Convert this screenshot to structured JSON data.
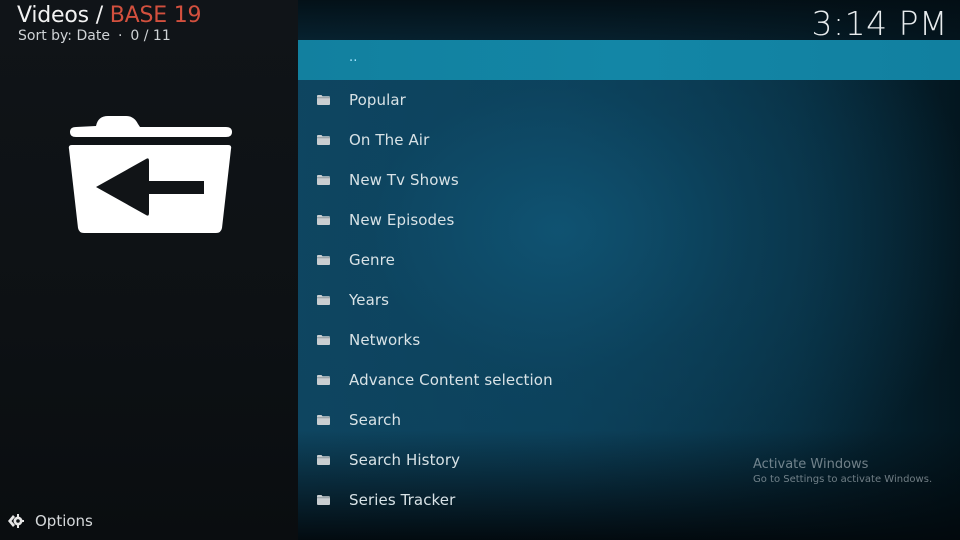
{
  "header": {
    "section": "Videos",
    "separator": " / ",
    "addon": "BASE 19",
    "sort_label": "Sort by: Date",
    "dot": "·",
    "position": "0 / 11"
  },
  "clock": "3:14 PM",
  "parent_icon": "folder-back-icon",
  "list": {
    "items": [
      {
        "label": "..",
        "icon": "none",
        "selected": true
      },
      {
        "label": "Popular",
        "icon": "folder-icon"
      },
      {
        "label": "On The Air",
        "icon": "folder-icon"
      },
      {
        "label": "New Tv Shows",
        "icon": "folder-icon"
      },
      {
        "label": "New Episodes",
        "icon": "folder-icon"
      },
      {
        "label": "Genre",
        "icon": "folder-icon"
      },
      {
        "label": "Years",
        "icon": "folder-icon"
      },
      {
        "label": "Networks",
        "icon": "folder-icon"
      },
      {
        "label": "Advance Content selection",
        "icon": "folder-icon"
      },
      {
        "label": "Search",
        "icon": "folder-icon"
      },
      {
        "label": "Search History",
        "icon": "folder-icon"
      },
      {
        "label": "Series Tracker",
        "icon": "folder-icon"
      }
    ]
  },
  "options": {
    "label": "Options",
    "icon": "options-gear-icon"
  },
  "watermark": {
    "title": "Activate Windows",
    "subtitle": "Go to Settings to activate Windows."
  },
  "colors": {
    "accent": "#d2503e",
    "selected_row": "#1386a6",
    "background": "#0e4560"
  }
}
